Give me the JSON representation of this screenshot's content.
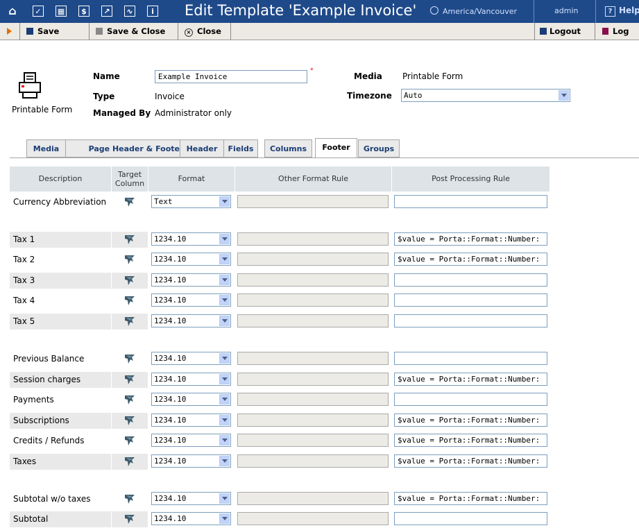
{
  "topbar": {
    "title": "Edit Template 'Example Invoice'",
    "timezone": "America/Vancouver",
    "user": "admin",
    "help": "Help",
    "icons": [
      "home-icon",
      "checkbox-icon",
      "grid-icon",
      "dollar-icon",
      "export-icon",
      "chart-icon",
      "info-icon"
    ]
  },
  "toolbar": {
    "save": "Save",
    "save_close": "Save & Close",
    "close": "Close",
    "logout": "Logout",
    "log": "Log"
  },
  "form": {
    "icon_label": "Printable Form",
    "name_label": "Name",
    "name_value": "Example Invoice",
    "required_mark": "*",
    "type_label": "Type",
    "type_value": "Invoice",
    "managed_label": "Managed By",
    "managed_value": "Administrator only",
    "media_label": "Media",
    "media_value": "Printable Form",
    "timezone_label": "Timezone",
    "timezone_value": "Auto"
  },
  "tabs": [
    "Media",
    "Page Header & Footer",
    "Header",
    "Fields",
    "Columns",
    "Footer",
    "Groups"
  ],
  "active_tab": "Footer",
  "table": {
    "headers": {
      "description": "Description",
      "target_line1": "Target",
      "target_line2": "Column",
      "format": "Format",
      "other": "Other Format Rule",
      "post": "Post Processing Rule"
    },
    "rows": [
      {
        "label": "Currency Abbreviation",
        "format": "Text",
        "post": ""
      },
      {
        "label": "Tax 1",
        "format": "1234.10",
        "post": "$value = Porta::Format::Number:"
      },
      {
        "label": "Tax 2",
        "format": "1234.10",
        "post": "$value = Porta::Format::Number:"
      },
      {
        "label": "Tax 3",
        "format": "1234.10",
        "post": ""
      },
      {
        "label": "Tax 4",
        "format": "1234.10",
        "post": ""
      },
      {
        "label": "Tax 5",
        "format": "1234.10",
        "post": ""
      },
      {
        "label": "Previous Balance",
        "format": "1234.10",
        "post": ""
      },
      {
        "label": "Session charges",
        "format": "1234.10",
        "post": "$value = Porta::Format::Number:"
      },
      {
        "label": "Payments",
        "format": "1234.10",
        "post": ""
      },
      {
        "label": "Subscriptions",
        "format": "1234.10",
        "post": "$value = Porta::Format::Number:"
      },
      {
        "label": "Credits / Refunds",
        "format": "1234.10",
        "post": "$value = Porta::Format::Number:"
      },
      {
        "label": "Taxes",
        "format": "1234.10",
        "post": "$value = Porta::Format::Number:"
      },
      {
        "label": "Subtotal w/o taxes",
        "format": "1234.10",
        "post": "$value = Porta::Format::Number:"
      },
      {
        "label": "Subtotal",
        "format": "1234.10",
        "post": ""
      }
    ]
  }
}
